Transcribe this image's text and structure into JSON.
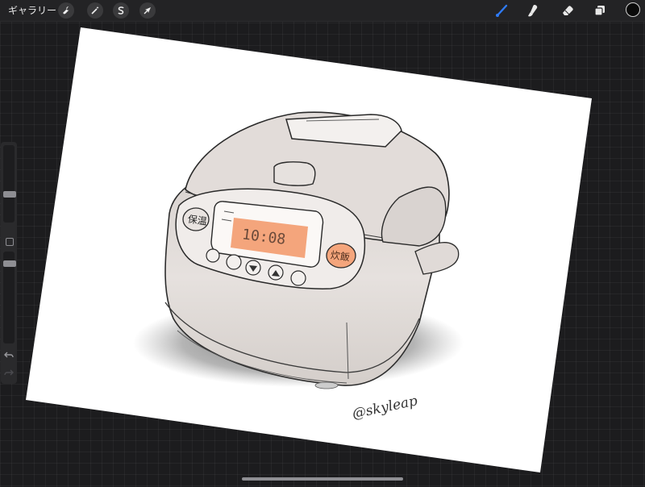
{
  "app": {
    "gallery_label": "ギャラリー",
    "accent_color": "#2f7bf6"
  },
  "toolbar": {
    "left_tools": [
      {
        "icon": "wrench-icon",
        "name": "actions"
      },
      {
        "icon": "magic-wand-icon",
        "name": "adjustments"
      },
      {
        "icon": "selection-s-icon",
        "name": "selection"
      },
      {
        "icon": "arrow-cursor-icon",
        "name": "transform"
      }
    ],
    "right_tools": [
      {
        "icon": "brush-icon",
        "name": "paint",
        "active": true
      },
      {
        "icon": "smudge-icon",
        "name": "smudge"
      },
      {
        "icon": "eraser-icon",
        "name": "erase"
      },
      {
        "icon": "layers-icon",
        "name": "layers"
      }
    ],
    "current_color": "#0a0a0a"
  },
  "sidebar": {
    "brush_size_level": 0.35,
    "opacity_level": 0.1
  },
  "canvas": {
    "panel_labels": {
      "left_button": "保温",
      "right_button": "炊飯"
    },
    "display_text": "10:08",
    "display_color": "#f4a57c",
    "signature": "@skyleap"
  }
}
